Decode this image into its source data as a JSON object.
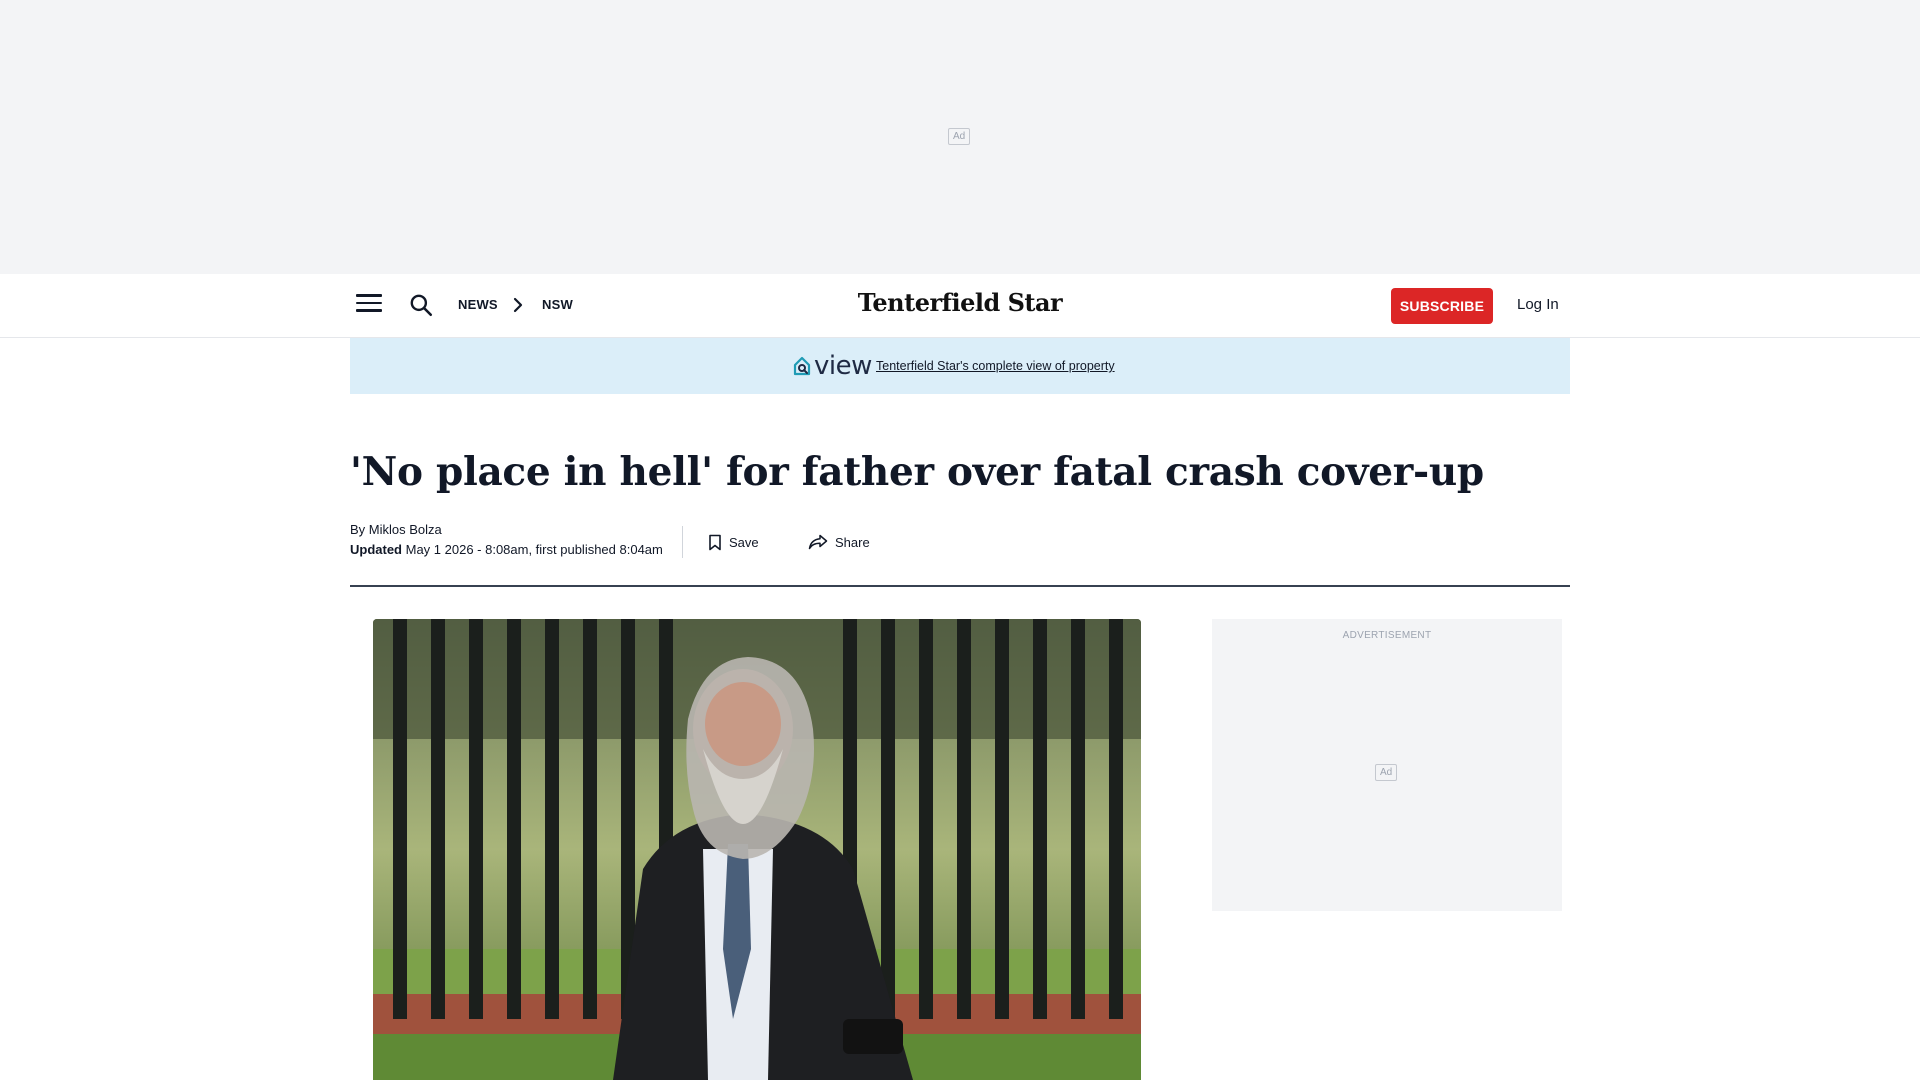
{
  "top_ad": {
    "chip": "Ad"
  },
  "header": {
    "breadcrumb": [
      "NEWS",
      "NSW"
    ],
    "logo": "Tenterfield Star",
    "subscribe": "SUBSCRIBE",
    "login": "Log In",
    "icons": [
      "menu-icon",
      "search-icon",
      "chevron-right-icon"
    ]
  },
  "banner": {
    "logo_word": "view",
    "link": "Tenterfield Star's complete view of property"
  },
  "article": {
    "headline": "'No place in hell' for father over fatal crash cover-up",
    "byline_prefix": "By ",
    "author": "Miklos Bolza",
    "updated_label": "Updated",
    "date_text": " May 1 2026 - 8:08am, first published 8:04am",
    "save": "Save",
    "share": "Share"
  },
  "sidebar_ad": {
    "label": "ADVERTISEMENT",
    "chip": "Ad"
  },
  "colors": {
    "accent": "#dc2626",
    "banner_bg": "#dbeef9",
    "ad_bg": "#f3f4f6"
  }
}
